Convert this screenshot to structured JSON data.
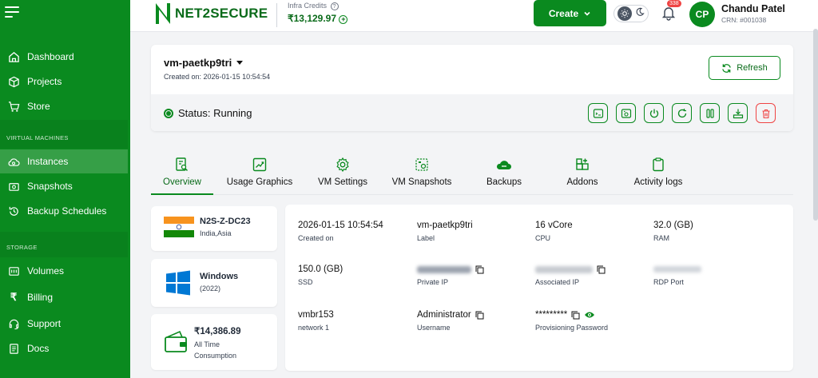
{
  "sidebar": {
    "items": [
      {
        "label": "Dashboard",
        "icon": "home-icon"
      },
      {
        "label": "Projects",
        "icon": "cube-icon"
      },
      {
        "label": "Store",
        "icon": "cart-icon"
      },
      {
        "label": "Instances",
        "icon": "cloud-icon"
      },
      {
        "label": "Snapshots",
        "icon": "snapshot-icon"
      },
      {
        "label": "Backup Schedules",
        "icon": "history-icon"
      },
      {
        "label": "Volumes",
        "icon": "volume-icon"
      },
      {
        "label": "Billing",
        "icon": "rupee-icon"
      },
      {
        "label": "Support",
        "icon": "headset-icon"
      },
      {
        "label": "Docs",
        "icon": "doc-icon"
      }
    ],
    "sections": {
      "virtual_machines": "VIRTUAL MACHINES",
      "storage": "STORAGE"
    },
    "active": "Instances"
  },
  "header": {
    "logo_text": "NET2SECURE",
    "credits_label": "Infra Credits",
    "credits_value": "₹13,129.97",
    "create_label": "Create",
    "notification_count": "338",
    "avatar_initials": "CP",
    "user_name": "Chandu Patel",
    "user_crn": "CRN: #001038"
  },
  "vm": {
    "name": "vm-paetkp9tri",
    "created": "Created on: 2026-01-15 10:54:54",
    "refresh_label": "Refresh",
    "status": "Status: Running"
  },
  "tabs": [
    "Overview",
    "Usage Graphics",
    "VM Settings",
    "VM Snapshots",
    "Backups",
    "Addons",
    "Activity logs"
  ],
  "region": {
    "name": "N2S-Z-DC23",
    "location": "India,Asia"
  },
  "os": {
    "name": "Windows",
    "version": "(2022)"
  },
  "consumption": {
    "amount": "₹14,386.89",
    "label": "All Time Consumption"
  },
  "details": [
    {
      "value": "2026-01-15 10:54:54",
      "key": "Created on"
    },
    {
      "value": "vm-paetkp9tri",
      "key": "Label"
    },
    {
      "value": "16 vCore",
      "key": "CPU"
    },
    {
      "value": "32.0 (GB)",
      "key": "RAM"
    },
    {
      "value": "150.0 (GB)",
      "key": "SSD"
    },
    {
      "value": "",
      "key": "Private IP"
    },
    {
      "value": "",
      "key": "Associated IP"
    },
    {
      "value": "",
      "key": "RDP Port"
    },
    {
      "value": "vmbr153",
      "key": "network 1"
    },
    {
      "value": "Administrator",
      "key": "Username"
    },
    {
      "value": "*********",
      "key": "Provisioning Password"
    }
  ],
  "colors": {
    "brand": "#0a8a1f",
    "danger": "#ef4444"
  }
}
